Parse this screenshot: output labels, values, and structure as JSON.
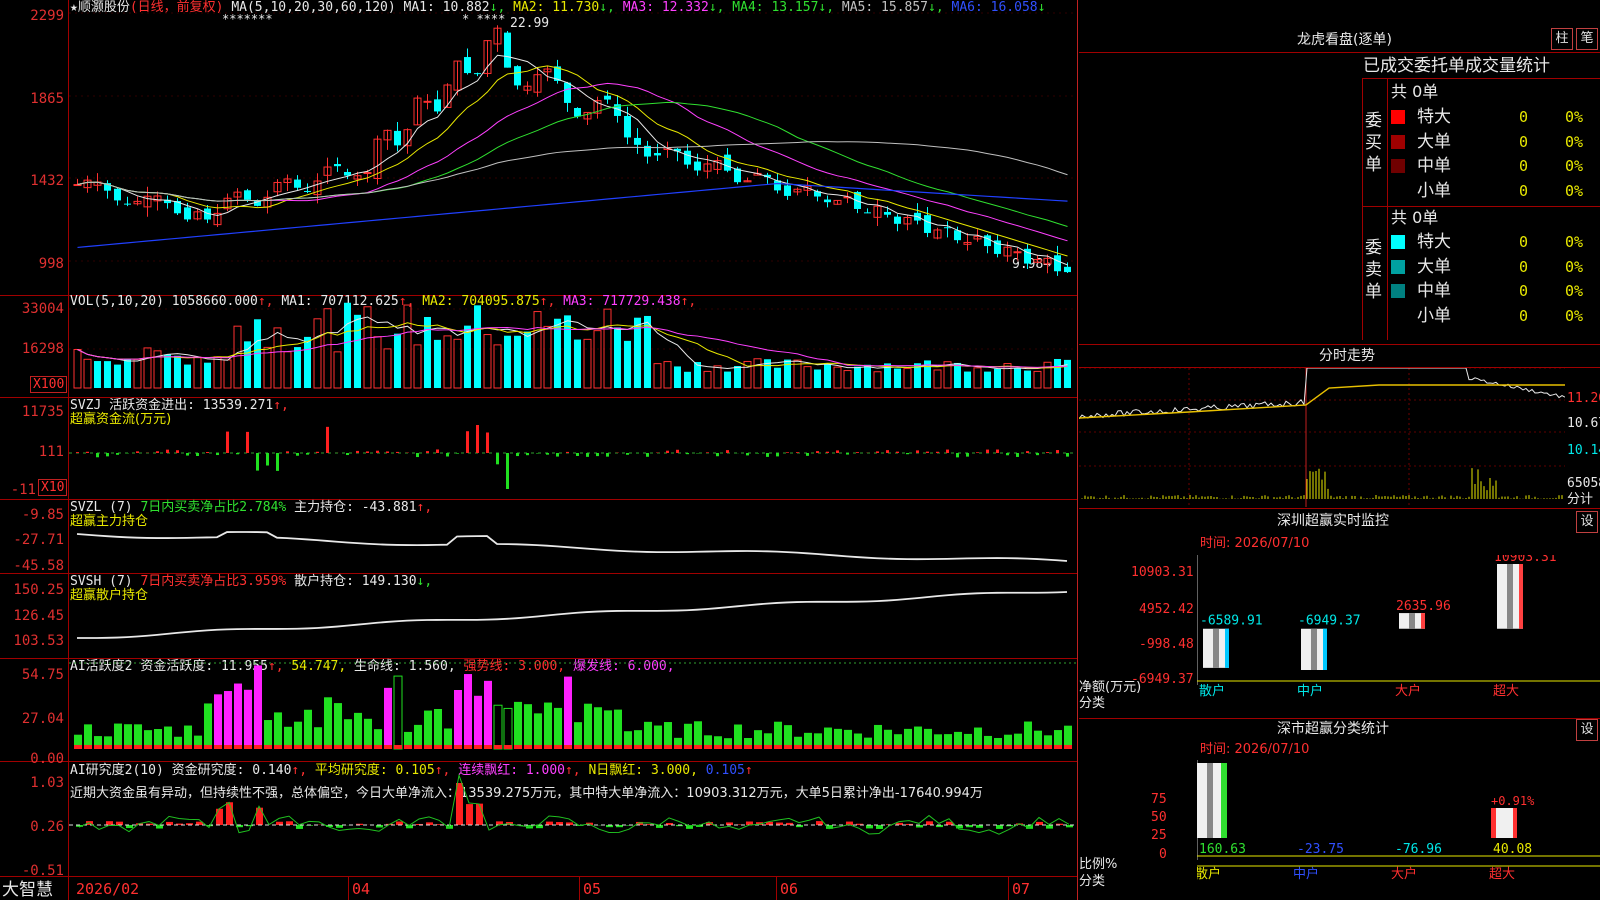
{
  "main": {
    "title": "顺灏股份",
    "period": "(日线，前复权)",
    "ma_label": "MA(5,10,20,30,60,120)",
    "ma_values": [
      {
        "name": "MA1",
        "value": "10.882",
        "dir": "↓",
        "color": "#e8e8e8"
      },
      {
        "name": "MA2",
        "value": "11.730",
        "dir": "↓",
        "color": "#e8e800"
      },
      {
        "name": "MA3",
        "value": "12.332",
        "dir": "↓",
        "color": "#ff40ff"
      },
      {
        "name": "MA4",
        "value": "13.157",
        "dir": "↓",
        "color": "#30e030"
      },
      {
        "name": "MA5",
        "value": "15.857",
        "dir": "↓",
        "color": "#c0c0c0"
      },
      {
        "name": "MA6",
        "value": "16.058",
        "dir": "↓",
        "color": "#3050ff"
      }
    ],
    "stars": "*******",
    "stars2": "*  ****",
    "high_label": "22.99",
    "low_label": "9.98→",
    "y_ticks": [
      "2299",
      "1865",
      "1432",
      "998"
    ]
  },
  "vol": {
    "label": "VOL(5,10,20)",
    "value": "1058660.000",
    "items": [
      {
        "name": "MA1",
        "value": "707112.625",
        "color": "#e8e8e8"
      },
      {
        "name": "MA2",
        "value": "704095.875",
        "color": "#e8e800"
      },
      {
        "name": "MA3",
        "value": "717729.438",
        "color": "#ff40ff"
      }
    ],
    "y_ticks": [
      "33004",
      "16298"
    ],
    "unit": "X100"
  },
  "svzj": {
    "label": "SVZJ",
    "desc": "活跃资金进出: 13539.271",
    "sub": "超赢资金流(万元)",
    "y_ticks": [
      "11735",
      "111",
      "-11"
    ],
    "unit": "X10"
  },
  "svzl": {
    "label": "SVZL (7)",
    "desc": "7日内买卖净占比2.784%",
    "desc2": "主力持仓: -43.881",
    "sub": "超赢主力持仓",
    "y_ticks": [
      "-9.85",
      "-27.71",
      "-45.58"
    ]
  },
  "svsh": {
    "label": "SVSH (7)",
    "desc": "7日内买卖净占比3.959%",
    "desc2": "散户持仓: 149.130",
    "sub": "超赢散户持仓",
    "y_ticks": [
      "150.25",
      "126.45",
      "103.53"
    ]
  },
  "ai1": {
    "label": "AI活跃度2",
    "desc": "资金活跃度: 11.955",
    "v2": "54.747",
    "v3": "生命线: 1.560",
    "v4": "强势线: 3.000",
    "v5": "爆发线: 6.000",
    "y_ticks": [
      "54.75",
      "27.04",
      "0.00"
    ]
  },
  "ai2": {
    "label": "AI研究度2(10)",
    "desc": "资金研究度: 0.140",
    "v2": "平均研究度: 0.105",
    "v3": "连续飘红: 1.000",
    "v4": "N日飘红: 3.000",
    "v5": "0.105",
    "text": "近期大资金虽有异动，但持续性不强，总体偏空，今日大单净流入：13539.275万元，其中特大单净流入：10903.312万元，大单5日累计净出-17640.994万",
    "y_ticks": [
      "1.03",
      "0.26",
      "-0.51"
    ]
  },
  "xaxis": {
    "app": "大智慧",
    "labels": [
      "2026/02",
      "04",
      "05",
      "06",
      "07"
    ]
  },
  "lhb": {
    "title": "龙虎看盘(逐单)",
    "btn1": "柱",
    "btn2": "笔",
    "subtitle": "已成交委托单成交量统计",
    "buy_label": "委买单",
    "sell_label": "委卖单",
    "buy_total": "共 0单",
    "sell_total": "共 0单",
    "buy_rows": [
      {
        "name": "特大",
        "count": "0",
        "pct": "0%",
        "color": "#ff0000"
      },
      {
        "name": "大单",
        "count": "0",
        "pct": "0%",
        "color": "#a00000"
      },
      {
        "name": "中单",
        "count": "0",
        "pct": "0%",
        "color": "#700000"
      },
      {
        "name": "小单",
        "count": "0",
        "pct": "0%",
        "color": "#000000"
      }
    ],
    "sell_rows": [
      {
        "name": "特大",
        "count": "0",
        "pct": "0%",
        "color": "#00ffff"
      },
      {
        "name": "大单",
        "count": "0",
        "pct": "0%",
        "color": "#00a0a0"
      },
      {
        "name": "中单",
        "count": "0",
        "pct": "0%",
        "color": "#008080"
      },
      {
        "name": "小单",
        "count": "0",
        "pct": "0%",
        "color": "#000000"
      }
    ]
  },
  "fenshi": {
    "title": "分时走势",
    "y_ticks": [
      "11.20",
      "10.67",
      "10.14",
      "65058"
    ],
    "unit": "分计"
  },
  "monitor": {
    "title": "深圳超赢实时监控",
    "btn": "设",
    "time": "时间: 2026/07/10",
    "y_ticks": [
      "10903.31",
      "4952.42",
      "-998.48",
      "-6949.37"
    ],
    "ylabel": "净额(万元)",
    "xlabel": "分类",
    "bars": [
      {
        "name": "散户",
        "value": "-6589.91",
        "num": -6589.91
      },
      {
        "name": "中户",
        "value": "-6949.37",
        "num": -6949.37
      },
      {
        "name": "大户",
        "value": "2635.96",
        "num": 2635.96
      },
      {
        "name": "超大",
        "value": "10903.31",
        "num": 10903.31
      }
    ]
  },
  "classify": {
    "title": "深市超赢分类统计",
    "btn": "设",
    "time": "时间: 2026/07/10",
    "y_ticks": [
      "75",
      "50",
      "25",
      "0"
    ],
    "ylabel": "比例%",
    "xlabel": "分类",
    "extra": "+0.91%",
    "bars": [
      {
        "name": "散户",
        "value": "160.63",
        "color": "#30e030"
      },
      {
        "name": "中户",
        "value": "-23.75",
        "color": "#3050ff"
      },
      {
        "name": "大户",
        "value": "-76.96",
        "color": "#00e8e8"
      },
      {
        "name": "超大",
        "value": "40.08",
        "color": "#e8e800"
      }
    ]
  }
}
